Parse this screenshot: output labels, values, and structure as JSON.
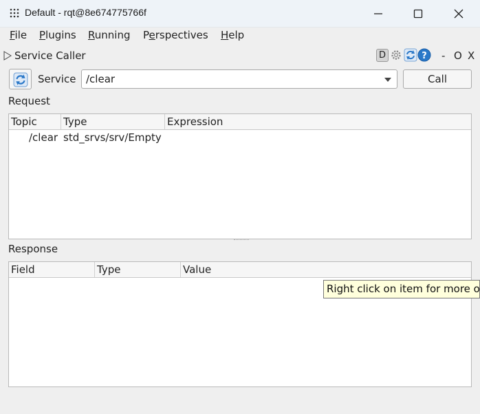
{
  "window": {
    "title": "Default - rqt@8e674775766f",
    "app_icon": "grid-dots-icon"
  },
  "menu": {
    "items": [
      {
        "label": "File",
        "mnemonic": "F",
        "rest": "ile"
      },
      {
        "label": "Plugins",
        "mnemonic": "P",
        "rest": "lugins"
      },
      {
        "label": "Running",
        "mnemonic": "R",
        "rest": "unning"
      },
      {
        "label": "Perspectives",
        "pre": "P",
        "mnemonic": "e",
        "rest": "rspectives"
      },
      {
        "label": "Help",
        "mnemonic": "H",
        "rest": "elp"
      }
    ]
  },
  "plugin": {
    "title": "Service Caller",
    "dock_badge": "D",
    "minimize": "-",
    "float": "O",
    "close": "X"
  },
  "controls": {
    "service_label": "Service",
    "service_value": "/clear",
    "call_label": "Call"
  },
  "request": {
    "section_label": "Request",
    "columns": [
      "Topic",
      "Type",
      "Expression"
    ],
    "rows": [
      {
        "topic": "/clear",
        "type": "std_srvs/srv/Empty",
        "expression": ""
      }
    ]
  },
  "response": {
    "section_label": "Response",
    "columns": [
      "Field",
      "Type",
      "Value"
    ],
    "rows": []
  },
  "tooltip": {
    "text": "Right click on item for more options"
  },
  "colors": {
    "titlebar_bg": "#eef3f8",
    "window_bg": "#efefef",
    "tooltip_bg": "#ffffdc",
    "refresh_icon_blue": "#2a78c8"
  }
}
